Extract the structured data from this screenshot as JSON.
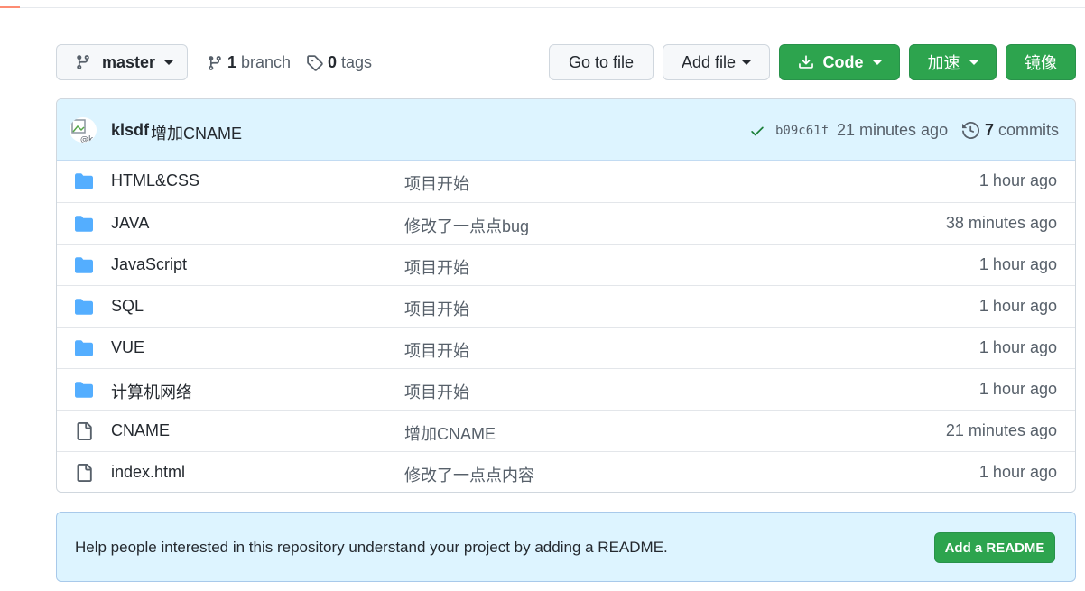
{
  "toolbar": {
    "branch_select": "master",
    "branches_count": "1",
    "branches_label": "branch",
    "tags_count": "0",
    "tags_label": "tags",
    "go_to_file": "Go to file",
    "add_file": "Add file",
    "code": "Code",
    "accelerate": "加速",
    "mirror": "镜像"
  },
  "latest_commit": {
    "author": "klsdf",
    "message": "增加CNAME",
    "sha": "b09c61f",
    "time": "21 minutes ago",
    "commits_count": "7",
    "commits_label": "commits"
  },
  "files": [
    {
      "type": "folder",
      "name": "HTML&CSS",
      "message": "项目开始",
      "age": "1 hour ago"
    },
    {
      "type": "folder",
      "name": "JAVA",
      "message": "修改了一点点bug",
      "age": "38 minutes ago"
    },
    {
      "type": "folder",
      "name": "JavaScript",
      "message": "项目开始",
      "age": "1 hour ago"
    },
    {
      "type": "folder",
      "name": "SQL",
      "message": "项目开始",
      "age": "1 hour ago"
    },
    {
      "type": "folder",
      "name": "VUE",
      "message": "项目开始",
      "age": "1 hour ago"
    },
    {
      "type": "folder",
      "name": "计算机网络",
      "message": "项目开始",
      "age": "1 hour ago"
    },
    {
      "type": "file",
      "name": "CNAME",
      "message": "增加CNAME",
      "age": "21 minutes ago"
    },
    {
      "type": "file",
      "name": "index.html",
      "message": "修改了一点点内容",
      "age": "1 hour ago"
    }
  ],
  "readme": {
    "text": "Help people interested in this repository understand your project by adding a README.",
    "button": "Add a README"
  },
  "colors": {
    "green": "#2da44e",
    "folder": "#54aeff",
    "header_bg": "#ddf4ff",
    "muted": "#57606a"
  }
}
